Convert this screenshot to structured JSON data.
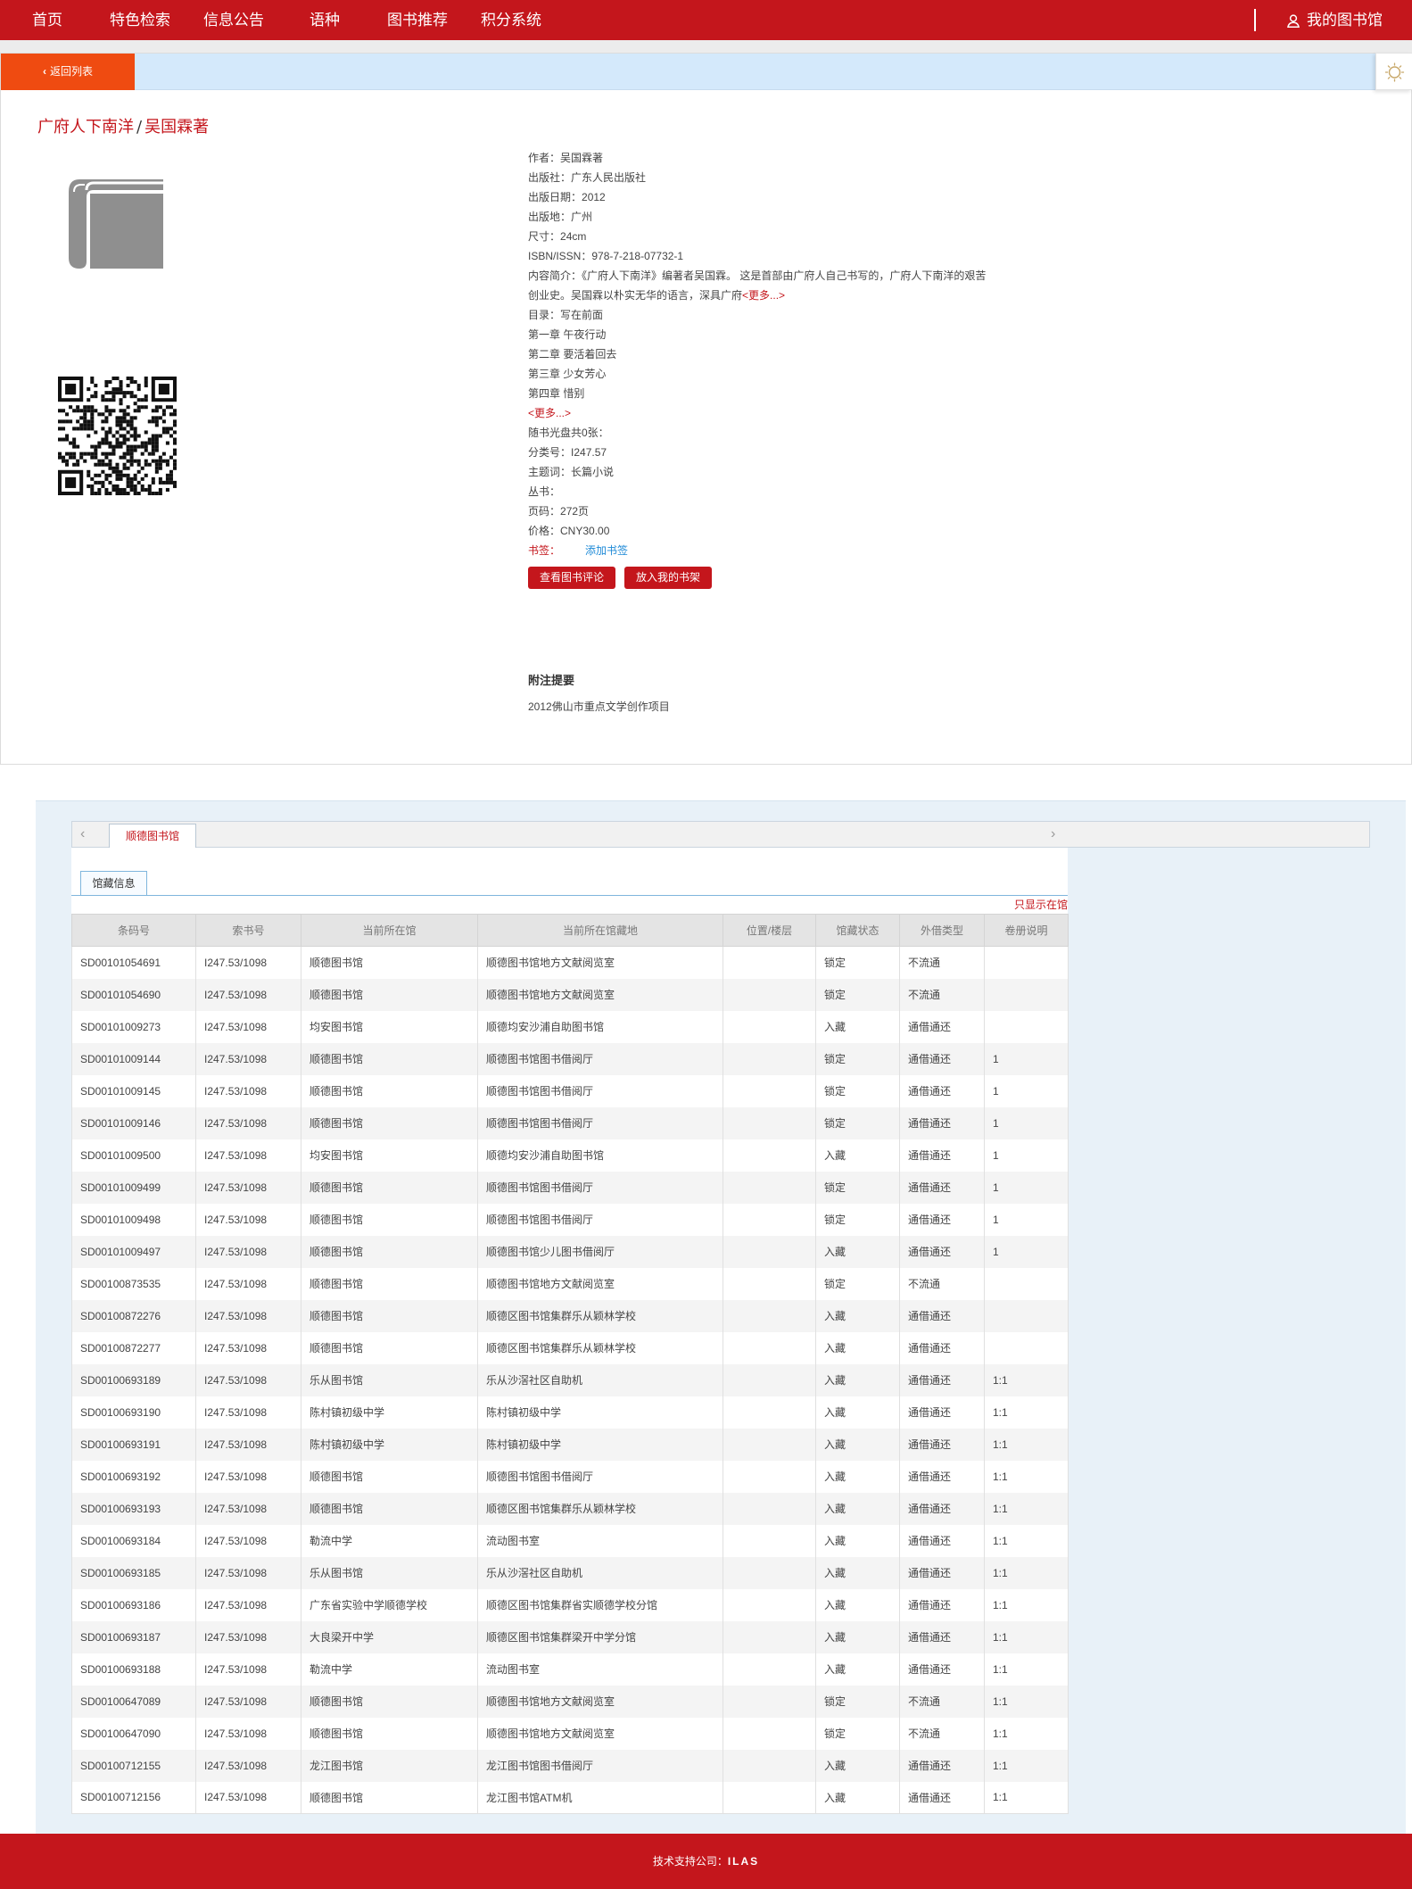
{
  "nav": {
    "items": [
      "首页",
      "特色检索",
      "信息公告",
      "语种",
      "图书推荐",
      "积分系统"
    ],
    "my_library": "我的图书馆"
  },
  "detail": {
    "back_label": "返回列表",
    "title": "广府人下南洋",
    "author_name": "吴国霖著",
    "fields": [
      {
        "label": "作者：",
        "value": "吴国霖著"
      },
      {
        "label": "出版社：",
        "value": "广东人民出版社"
      },
      {
        "label": "出版日期：",
        "value": "2012"
      },
      {
        "label": "出版地：",
        "value": "广州"
      },
      {
        "label": "尺寸：",
        "value": "24cm"
      },
      {
        "label": "ISBN/ISSN：",
        "value": "978-7-218-07732-1"
      }
    ],
    "summary_label": "内容简介：",
    "summary_line1": "《广府人下南洋》编著者吴国霖。 这是首部由广府人自己书写的，广府人下南洋的艰苦",
    "summary_line2": "创业史。吴国霖以朴实无华的语言，深具广府",
    "more": "<更多...>",
    "toc_label": "目录：",
    "toc": [
      "写在前面",
      "第一章 午夜行动",
      "第二章 要活着回去",
      "第三章 少女芳心",
      "第四章 惜别"
    ],
    "fields2": [
      {
        "label": "随书光盘共0张：",
        "value": ""
      },
      {
        "label": "分类号：",
        "value": "I247.57"
      },
      {
        "label": "主题词：",
        "value": "长篇小说"
      },
      {
        "label": "丛书：",
        "value": ""
      },
      {
        "label": "页码：",
        "value": "272页"
      },
      {
        "label": "价格：",
        "value": "CNY30.00"
      }
    ],
    "bookmark_label": "书签：",
    "add_bookmark": "添加书签",
    "btn_review": "查看图书评论",
    "btn_shelf": "放入我的书架",
    "notes_title": "附注提要",
    "notes_text": "2012佛山市重点文学创作项目"
  },
  "holdings": {
    "library_tab": "顺德图书馆",
    "subtab": "馆藏信息",
    "only_show": "只显示在馆",
    "columns": [
      "条码号",
      "索书号",
      "当前所在馆",
      "当前所在馆藏地",
      "位置/楼层",
      "馆藏状态",
      "外借类型",
      "卷册说明"
    ],
    "rows": [
      [
        "SD00101054691",
        "I247.53/1098",
        "顺德图书馆",
        "顺德图书馆地方文献阅览室",
        "",
        "锁定",
        "不流通",
        ""
      ],
      [
        "SD00101054690",
        "I247.53/1098",
        "顺德图书馆",
        "顺德图书馆地方文献阅览室",
        "",
        "锁定",
        "不流通",
        ""
      ],
      [
        "SD00101009273",
        "I247.53/1098",
        "均安图书馆",
        "顺德均安沙浦自助图书馆",
        "",
        "入藏",
        "通借通还",
        ""
      ],
      [
        "SD00101009144",
        "I247.53/1098",
        "顺德图书馆",
        "顺德图书馆图书借阅厅",
        "",
        "锁定",
        "通借通还",
        "1"
      ],
      [
        "SD00101009145",
        "I247.53/1098",
        "顺德图书馆",
        "顺德图书馆图书借阅厅",
        "",
        "锁定",
        "通借通还",
        "1"
      ],
      [
        "SD00101009146",
        "I247.53/1098",
        "顺德图书馆",
        "顺德图书馆图书借阅厅",
        "",
        "锁定",
        "通借通还",
        "1"
      ],
      [
        "SD00101009500",
        "I247.53/1098",
        "均安图书馆",
        "顺德均安沙浦自助图书馆",
        "",
        "入藏",
        "通借通还",
        "1"
      ],
      [
        "SD00101009499",
        "I247.53/1098",
        "顺德图书馆",
        "顺德图书馆图书借阅厅",
        "",
        "锁定",
        "通借通还",
        "1"
      ],
      [
        "SD00101009498",
        "I247.53/1098",
        "顺德图书馆",
        "顺德图书馆图书借阅厅",
        "",
        "锁定",
        "通借通还",
        "1"
      ],
      [
        "SD00101009497",
        "I247.53/1098",
        "顺德图书馆",
        "顺德图书馆少儿图书借阅厅",
        "",
        "入藏",
        "通借通还",
        "1"
      ],
      [
        "SD00100873535",
        "I247.53/1098",
        "顺德图书馆",
        "顺德图书馆地方文献阅览室",
        "",
        "锁定",
        "不流通",
        ""
      ],
      [
        "SD00100872276",
        "I247.53/1098",
        "顺德图书馆",
        "顺德区图书馆集群乐从颖林学校",
        "",
        "入藏",
        "通借通还",
        ""
      ],
      [
        "SD00100872277",
        "I247.53/1098",
        "顺德图书馆",
        "顺德区图书馆集群乐从颖林学校",
        "",
        "入藏",
        "通借通还",
        ""
      ],
      [
        "SD00100693189",
        "I247.53/1098",
        "乐从图书馆",
        "乐从沙滘社区自助机",
        "",
        "入藏",
        "通借通还",
        "1:1"
      ],
      [
        "SD00100693190",
        "I247.53/1098",
        "陈村镇初级中学",
        "陈村镇初级中学",
        "",
        "入藏",
        "通借通还",
        "1:1"
      ],
      [
        "SD00100693191",
        "I247.53/1098",
        "陈村镇初级中学",
        "陈村镇初级中学",
        "",
        "入藏",
        "通借通还",
        "1:1"
      ],
      [
        "SD00100693192",
        "I247.53/1098",
        "顺德图书馆",
        "顺德图书馆图书借阅厅",
        "",
        "入藏",
        "通借通还",
        "1:1"
      ],
      [
        "SD00100693193",
        "I247.53/1098",
        "顺德图书馆",
        "顺德区图书馆集群乐从颖林学校",
        "",
        "入藏",
        "通借通还",
        "1:1"
      ],
      [
        "SD00100693184",
        "I247.53/1098",
        "勒流中学",
        "流动图书室",
        "",
        "入藏",
        "通借通还",
        "1:1"
      ],
      [
        "SD00100693185",
        "I247.53/1098",
        "乐从图书馆",
        "乐从沙滘社区自助机",
        "",
        "入藏",
        "通借通还",
        "1:1"
      ],
      [
        "SD00100693186",
        "I247.53/1098",
        "广东省实验中学顺德学校",
        "顺德区图书馆集群省实顺德学校分馆",
        "",
        "入藏",
        "通借通还",
        "1:1"
      ],
      [
        "SD00100693187",
        "I247.53/1098",
        "大良梁开中学",
        "顺德区图书馆集群梁开中学分馆",
        "",
        "入藏",
        "通借通还",
        "1:1"
      ],
      [
        "SD00100693188",
        "I247.53/1098",
        "勒流中学",
        "流动图书室",
        "",
        "入藏",
        "通借通还",
        "1:1"
      ],
      [
        "SD00100647089",
        "I247.53/1098",
        "顺德图书馆",
        "顺德图书馆地方文献阅览室",
        "",
        "锁定",
        "不流通",
        "1:1"
      ],
      [
        "SD00100647090",
        "I247.53/1098",
        "顺德图书馆",
        "顺德图书馆地方文献阅览室",
        "",
        "锁定",
        "不流通",
        "1:1"
      ],
      [
        "SD00100712155",
        "I247.53/1098",
        "龙江图书馆",
        "龙江图书馆图书借阅厅",
        "",
        "入藏",
        "通借通还",
        "1:1"
      ],
      [
        "SD00100712156",
        "I247.53/1098",
        "顺德图书馆",
        "龙江图书馆ATM机",
        "",
        "入藏",
        "通借通还",
        "1:1"
      ]
    ]
  },
  "footer": {
    "label": "技术支持公司：",
    "company": "ILAS"
  }
}
